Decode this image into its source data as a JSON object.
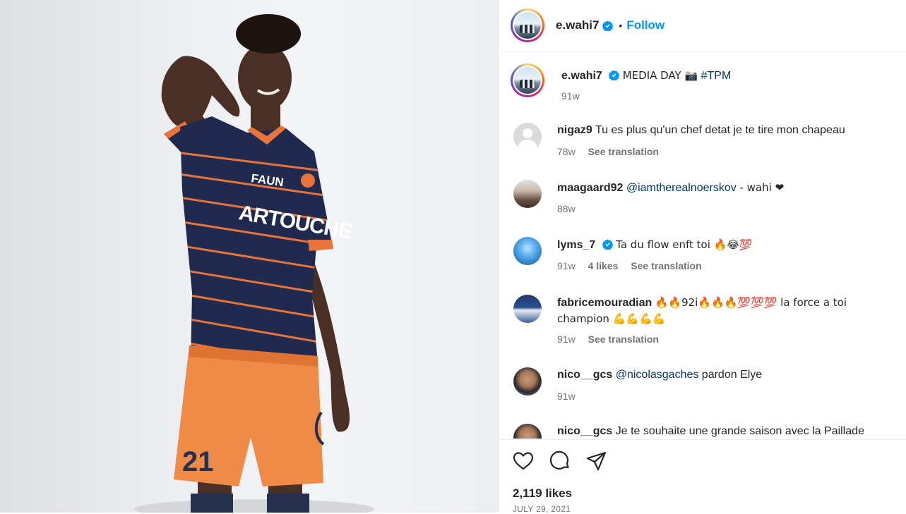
{
  "post": {
    "username": "e.wahi7",
    "follow_label": "Follow",
    "separator": "•",
    "caption_text": "MEDIA DAY 📷",
    "caption_tag": "#TPM",
    "caption_age": "91w",
    "likes": "2,119 likes",
    "date": "JULY 29, 2021",
    "jersey_number": "21",
    "sponsor": "FAUN"
  },
  "comments": [
    {
      "user": "nigaz9",
      "text": "Tu es plus qu'un chef detat je te tire mon chapeau",
      "age": "78w",
      "likes": "",
      "translate": "See translation"
    },
    {
      "user": "maagaard92",
      "mention": "@iamtherealnoerskov",
      "text": " - wahi ❤",
      "age": "88w",
      "likes": "",
      "translate": ""
    },
    {
      "user": "lyms_7",
      "text": "Ta du flow enft toi 🔥😂💯",
      "age": "91w",
      "likes": "4 likes",
      "translate": "See translation"
    },
    {
      "user": "fabricemouradian",
      "text": "🔥🔥92i🔥🔥🔥💯💯💯 la force a toi",
      "text2": "champion 💪💪💪💪",
      "age": "91w",
      "likes": "",
      "translate": "See translation"
    },
    {
      "user": "nico__gcs",
      "mention": "@nicolasgaches",
      "text": " pardon Elye",
      "age": "91w",
      "likes": "",
      "translate": ""
    },
    {
      "user": "nico__gcs",
      "text": "Je te souhaite une grande saison avec la Paillade",
      "age": "",
      "likes": "",
      "translate": ""
    }
  ],
  "colors": {
    "accent": "#0095f6",
    "jersey": "#1f2a4e",
    "stripe": "#e8743b",
    "shorts": "#f08a47"
  },
  "icons": [
    "heart-icon",
    "comment-icon",
    "share-icon",
    "verified-icon"
  ]
}
